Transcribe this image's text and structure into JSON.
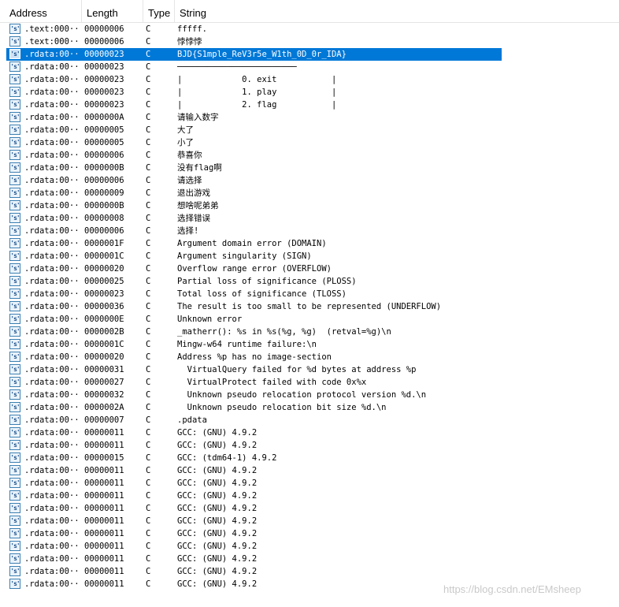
{
  "columns": {
    "address": "Address",
    "length": "Length",
    "type": "Type",
    "string": "String"
  },
  "icon_label": "'s'",
  "selected_row": 2,
  "rows": [
    {
      "address": ".text:000···",
      "length": "00000006",
      "type": "C",
      "string": "fffff."
    },
    {
      "address": ".text:000···",
      "length": "00000006",
      "type": "C",
      "string": "悖悖悖"
    },
    {
      "address": ".rdata:00···",
      "length": "00000023",
      "type": "C",
      "string": "BJD{S1mple_ReV3r5e_W1th_0D_0r_IDA}"
    },
    {
      "address": ".rdata:00···",
      "length": "00000023",
      "type": "C",
      "string": "────────────────────────"
    },
    {
      "address": ".rdata:00···",
      "length": "00000023",
      "type": "C",
      "string": "|            0. exit           |"
    },
    {
      "address": ".rdata:00···",
      "length": "00000023",
      "type": "C",
      "string": "|            1. play           |"
    },
    {
      "address": ".rdata:00···",
      "length": "00000023",
      "type": "C",
      "string": "|            2. flag           |"
    },
    {
      "address": ".rdata:00···",
      "length": "0000000A",
      "type": "C",
      "string": "请输入数字"
    },
    {
      "address": ".rdata:00···",
      "length": "00000005",
      "type": "C",
      "string": "大了"
    },
    {
      "address": ".rdata:00···",
      "length": "00000005",
      "type": "C",
      "string": "小了"
    },
    {
      "address": ".rdata:00···",
      "length": "00000006",
      "type": "C",
      "string": "恭喜你"
    },
    {
      "address": ".rdata:00···",
      "length": "0000000B",
      "type": "C",
      "string": "没有flag啊"
    },
    {
      "address": ".rdata:00···",
      "length": "00000006",
      "type": "C",
      "string": "请选择"
    },
    {
      "address": ".rdata:00···",
      "length": "00000009",
      "type": "C",
      "string": "退出游戏"
    },
    {
      "address": ".rdata:00···",
      "length": "0000000B",
      "type": "C",
      "string": "想啥呢弟弟"
    },
    {
      "address": ".rdata:00···",
      "length": "00000008",
      "type": "C",
      "string": "选择错误"
    },
    {
      "address": ".rdata:00···",
      "length": "00000006",
      "type": "C",
      "string": "选择!"
    },
    {
      "address": ".rdata:00···",
      "length": "0000001F",
      "type": "C",
      "string": "Argument domain error (DOMAIN)"
    },
    {
      "address": ".rdata:00···",
      "length": "0000001C",
      "type": "C",
      "string": "Argument singularity (SIGN)"
    },
    {
      "address": ".rdata:00···",
      "length": "00000020",
      "type": "C",
      "string": "Overflow range error (OVERFLOW)"
    },
    {
      "address": ".rdata:00···",
      "length": "00000025",
      "type": "C",
      "string": "Partial loss of significance (PLOSS)"
    },
    {
      "address": ".rdata:00···",
      "length": "00000023",
      "type": "C",
      "string": "Total loss of significance (TLOSS)"
    },
    {
      "address": ".rdata:00···",
      "length": "00000036",
      "type": "C",
      "string": "The result is too small to be represented (UNDERFLOW)"
    },
    {
      "address": ".rdata:00···",
      "length": "0000000E",
      "type": "C",
      "string": "Unknown error"
    },
    {
      "address": ".rdata:00···",
      "length": "0000002B",
      "type": "C",
      "string": "_matherr(): %s in %s(%g, %g)  (retval=%g)\\n"
    },
    {
      "address": ".rdata:00···",
      "length": "0000001C",
      "type": "C",
      "string": "Mingw-w64 runtime failure:\\n"
    },
    {
      "address": ".rdata:00···",
      "length": "00000020",
      "type": "C",
      "string": "Address %p has no image-section"
    },
    {
      "address": ".rdata:00···",
      "length": "00000031",
      "type": "C",
      "string": "  VirtualQuery failed for %d bytes at address %p"
    },
    {
      "address": ".rdata:00···",
      "length": "00000027",
      "type": "C",
      "string": "  VirtualProtect failed with code 0x%x"
    },
    {
      "address": ".rdata:00···",
      "length": "00000032",
      "type": "C",
      "string": "  Unknown pseudo relocation protocol version %d.\\n"
    },
    {
      "address": ".rdata:00···",
      "length": "0000002A",
      "type": "C",
      "string": "  Unknown pseudo relocation bit size %d.\\n"
    },
    {
      "address": ".rdata:00···",
      "length": "00000007",
      "type": "C",
      "string": ".pdata"
    },
    {
      "address": ".rdata:00···",
      "length": "00000011",
      "type": "C",
      "string": "GCC: (GNU) 4.9.2"
    },
    {
      "address": ".rdata:00···",
      "length": "00000011",
      "type": "C",
      "string": "GCC: (GNU) 4.9.2"
    },
    {
      "address": ".rdata:00···",
      "length": "00000015",
      "type": "C",
      "string": "GCC: (tdm64-1) 4.9.2"
    },
    {
      "address": ".rdata:00···",
      "length": "00000011",
      "type": "C",
      "string": "GCC: (GNU) 4.9.2"
    },
    {
      "address": ".rdata:00···",
      "length": "00000011",
      "type": "C",
      "string": "GCC: (GNU) 4.9.2"
    },
    {
      "address": ".rdata:00···",
      "length": "00000011",
      "type": "C",
      "string": "GCC: (GNU) 4.9.2"
    },
    {
      "address": ".rdata:00···",
      "length": "00000011",
      "type": "C",
      "string": "GCC: (GNU) 4.9.2"
    },
    {
      "address": ".rdata:00···",
      "length": "00000011",
      "type": "C",
      "string": "GCC: (GNU) 4.9.2"
    },
    {
      "address": ".rdata:00···",
      "length": "00000011",
      "type": "C",
      "string": "GCC: (GNU) 4.9.2"
    },
    {
      "address": ".rdata:00···",
      "length": "00000011",
      "type": "C",
      "string": "GCC: (GNU) 4.9.2"
    },
    {
      "address": ".rdata:00···",
      "length": "00000011",
      "type": "C",
      "string": "GCC: (GNU) 4.9.2"
    },
    {
      "address": ".rdata:00···",
      "length": "00000011",
      "type": "C",
      "string": "GCC: (GNU) 4.9.2"
    },
    {
      "address": ".rdata:00···",
      "length": "00000011",
      "type": "C",
      "string": "GCC: (GNU) 4.9.2"
    }
  ],
  "watermark": "https://blog.csdn.net/EMsheep"
}
